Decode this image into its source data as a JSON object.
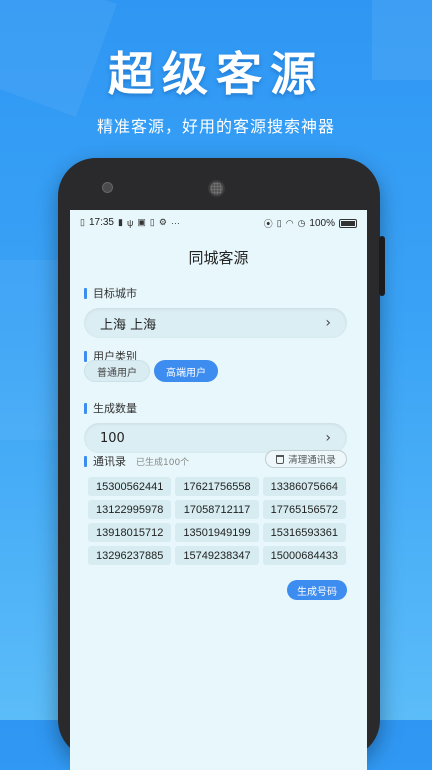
{
  "headline": "超级客源",
  "tagline": "精准客源，好用的客源搜索神器",
  "status_bar": {
    "time": "17:35",
    "battery": "100%"
  },
  "app": {
    "title": "同城客源",
    "target_city": {
      "label": "目标城市",
      "value": "上海 上海"
    },
    "user_type": {
      "label": "用户类别",
      "options": [
        "普通用户",
        "高端用户"
      ],
      "selected": "高端用户"
    },
    "quantity": {
      "label": "生成数量",
      "value": "100"
    },
    "address_book": {
      "label": "通讯录",
      "sub": "已生成100个",
      "clear_label": "清理通讯录",
      "numbers": [
        "15300562441",
        "17621756558",
        "13386075664",
        "13122995978",
        "17058712117",
        "17765156572",
        "13918015712",
        "13501949199",
        "15316593361",
        "13296237885",
        "15749238347",
        "15000684433"
      ]
    },
    "generate_label": "生成号码"
  },
  "colors": {
    "accent": "#3d8cf0",
    "background": "#2f97f3",
    "screen": "#e8f7fb"
  }
}
